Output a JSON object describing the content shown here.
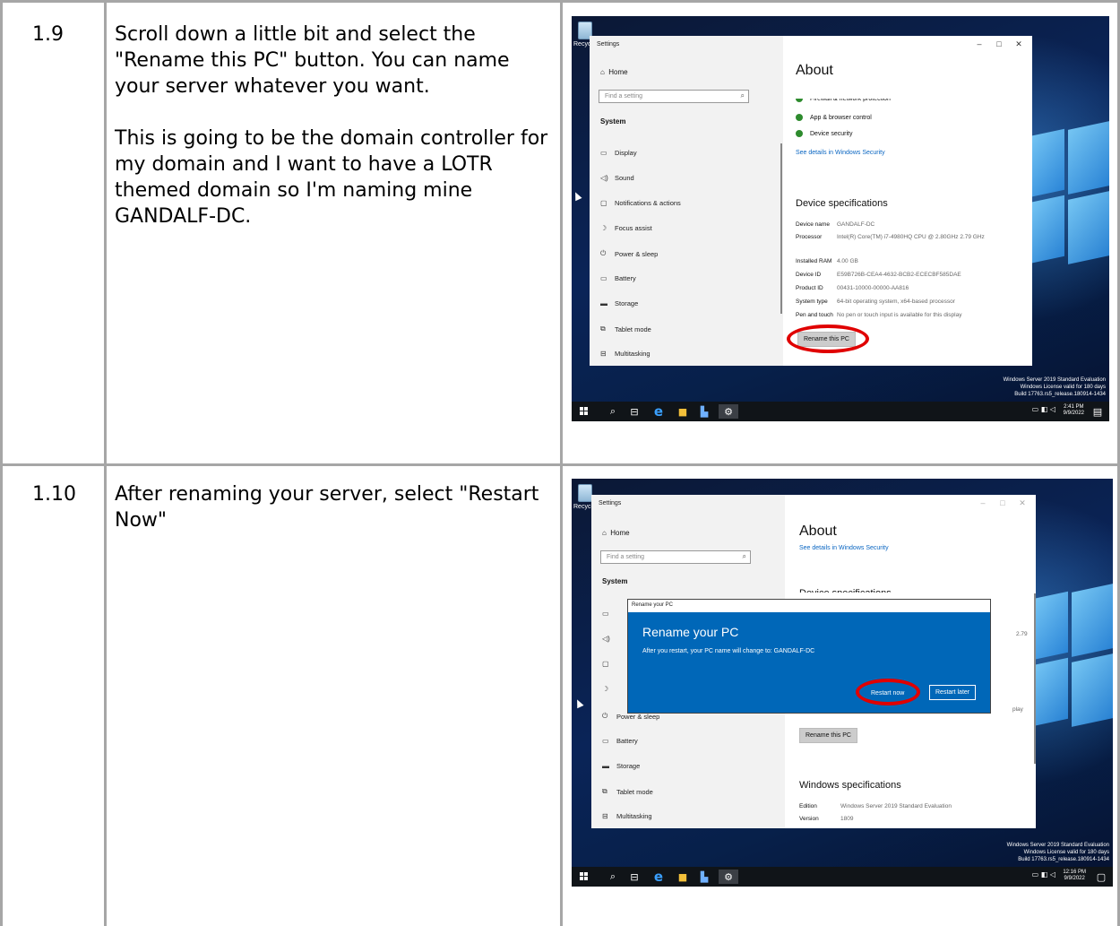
{
  "rows": [
    {
      "step": "1.9",
      "paragraphs": [
        "Scroll down a little bit and select the \"Rename this PC\" button. You can name your server whatever you want.",
        "This is going to be the domain controller for my domain and I want to have a LOTR themed domain so I'm naming mine GANDALF-DC."
      ]
    },
    {
      "step": "1.10",
      "paragraphs": [
        "After renaming your server, select \"Restart Now\""
      ]
    }
  ],
  "desktop": {
    "recycle_label": "Recycle",
    "watermark": [
      "Windows Server 2019 Standard Evaluation",
      "Windows License valid for 180 days",
      "Build 17763.rs5_release.180914-1434"
    ]
  },
  "settings": {
    "window_title": "Settings",
    "home": "Home",
    "search_placeholder": "Find a setting",
    "section": "System",
    "nav": [
      "Display",
      "Sound",
      "Notifications & actions",
      "Focus assist",
      "Power & sleep",
      "Battery",
      "Storage",
      "Tablet mode",
      "Multitasking"
    ],
    "about_heading": "About",
    "security_items": [
      "Firewall & network protection",
      "App & browser control",
      "Device security"
    ],
    "security_link": "See details in Windows Security",
    "device_spec_heading": "Device specifications",
    "specs": [
      {
        "k": "Device name",
        "v": "GANDALF-DC"
      },
      {
        "k": "Processor",
        "v": "Intel(R) Core(TM) i7-4980HQ CPU @ 2.80GHz  2.79 GHz"
      },
      {
        "k": "Installed RAM",
        "v": "4.00 GB"
      },
      {
        "k": "Device ID",
        "v": "E59B726B-CEA4-4632-BCB2-ECECBF585DAE"
      },
      {
        "k": "Product ID",
        "v": "00431-10000-00000-AA816"
      },
      {
        "k": "System type",
        "v": "64-bit operating system, x64-based processor"
      },
      {
        "k": "Pen and touch",
        "v": "No pen or touch input is available for this display"
      }
    ],
    "rename_button": "Rename this PC",
    "windows_spec_heading": "Windows specifications",
    "win_specs": [
      {
        "k": "Edition",
        "v": "Windows Server 2019 Standard Evaluation"
      },
      {
        "k": "Version",
        "v": "1809"
      }
    ],
    "partial_spec_heading": "Device specifications",
    "partial_279": "2.79",
    "partial_display": "play"
  },
  "dialog": {
    "window_label": "Rename your PC",
    "title": "Rename your PC",
    "message": "After you restart, your PC name will change to: GANDALF-DC",
    "restart_now": "Restart now",
    "restart_later": "Restart later"
  },
  "taskbar": [
    {
      "time": "2:41 PM",
      "date": "9/9/2022"
    },
    {
      "time": "12:16 PM",
      "date": "9/9/2022"
    }
  ],
  "colors": {
    "grid": "#a6a6a6",
    "accent_blue": "#0067b8",
    "highlight_red": "#e00000",
    "link_blue": "#0a66c2"
  }
}
